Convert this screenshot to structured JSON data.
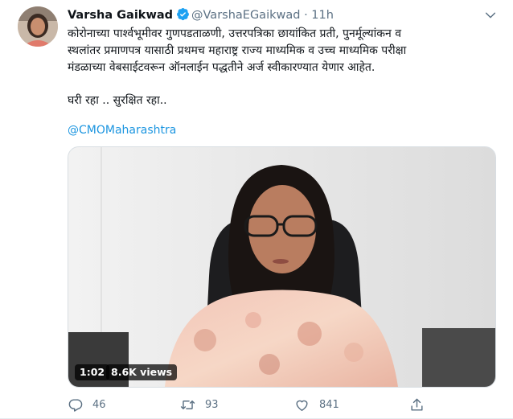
{
  "tweet": {
    "author_name": "Varsha Gaikwad",
    "handle": "@VarshaEGaikwad",
    "separator": "·",
    "time": "11h",
    "body_lines": [
      "कोरोनाच्या पार्श्वभूमीवर गुणपडताळणी, उत्तरपत्रिका छायांकित प्रती, पुनर्मूल्यांकन व",
      "स्थलांतर प्रमाणपत्र यासाठी प्रथमच महाराष्ट्र राज्य माध्यमिक व उच्च माध्यमिक परीक्षा",
      "मंडळाच्या वेबसाईटवरून ऑनलाईन पद्धतीने अर्ज स्वीकारण्यात येणार आहेत."
    ],
    "body_line2": "घरी रहा .. सुरक्षित रहा..",
    "mention": "@CMOMaharashtra"
  },
  "video": {
    "duration": "1:02",
    "views": "8.6K views"
  },
  "actions": {
    "reply_count": "46",
    "retweet_count": "93",
    "like_count": "841"
  },
  "colors": {
    "accent": "#1da1f2",
    "muted": "#5b7083",
    "link": "#1b95e0"
  },
  "icons": [
    "verified-badge-icon",
    "chevron-down-icon",
    "reply-icon",
    "retweet-icon",
    "like-icon",
    "share-icon"
  ]
}
